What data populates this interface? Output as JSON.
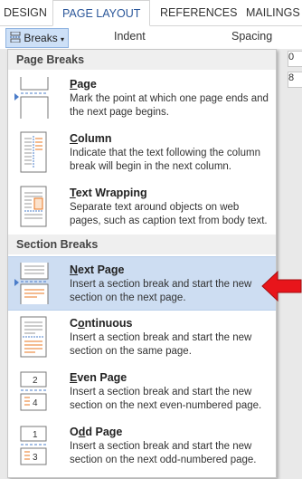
{
  "ribbon": {
    "tabs": [
      "DESIGN",
      "PAGE LAYOUT",
      "REFERENCES",
      "MAILINGS"
    ],
    "active_tab": "PAGE LAYOUT",
    "breaks_label": "Breaks",
    "indent_label": "Indent",
    "spacing_label": "Spacing",
    "indent_value_stub": "0",
    "spacing_value_stub": "8"
  },
  "menu": {
    "page_breaks_header": "Page Breaks",
    "section_breaks_header": "Section Breaks",
    "items": [
      {
        "title": "Page",
        "access_key": "P",
        "desc": "Mark the point at which one page ends and the next page begins."
      },
      {
        "title": "Column",
        "access_key": "C",
        "desc": "Indicate that the text following the column break will begin in the next column."
      },
      {
        "title": "Text Wrapping",
        "access_key": "T",
        "desc": "Separate text around objects on web pages, such as caption text from body text."
      },
      {
        "title": "Next Page",
        "access_key": "N",
        "desc": "Insert a section break and start the new section on the next page."
      },
      {
        "title": "Continuous",
        "access_key": "O",
        "desc": "Insert a section break and start the new section on the same page."
      },
      {
        "title": "Even Page",
        "access_key": "E",
        "desc": "Insert a section break and start the new section on the next even-numbered page."
      },
      {
        "title": "Odd Page",
        "access_key": "D",
        "desc": "Insert a section break and start the new section on the next odd-numbered page."
      }
    ],
    "highlighted_item": "Next Page"
  },
  "icons": {
    "page": "page-break-icon",
    "column": "column-break-icon",
    "text_wrapping": "text-wrapping-break-icon",
    "next_page": "next-page-section-icon",
    "continuous": "continuous-section-icon",
    "even_page": "even-page-section-icon",
    "odd_page": "odd-page-section-icon",
    "even_page_numbers": [
      "2",
      "4"
    ],
    "odd_page_numbers": [
      "1",
      "3"
    ]
  },
  "colors": {
    "accent": "#2b579a",
    "highlight": "#cdddf2",
    "arrow": "#e8151b",
    "icon_orange": "#e87722"
  }
}
